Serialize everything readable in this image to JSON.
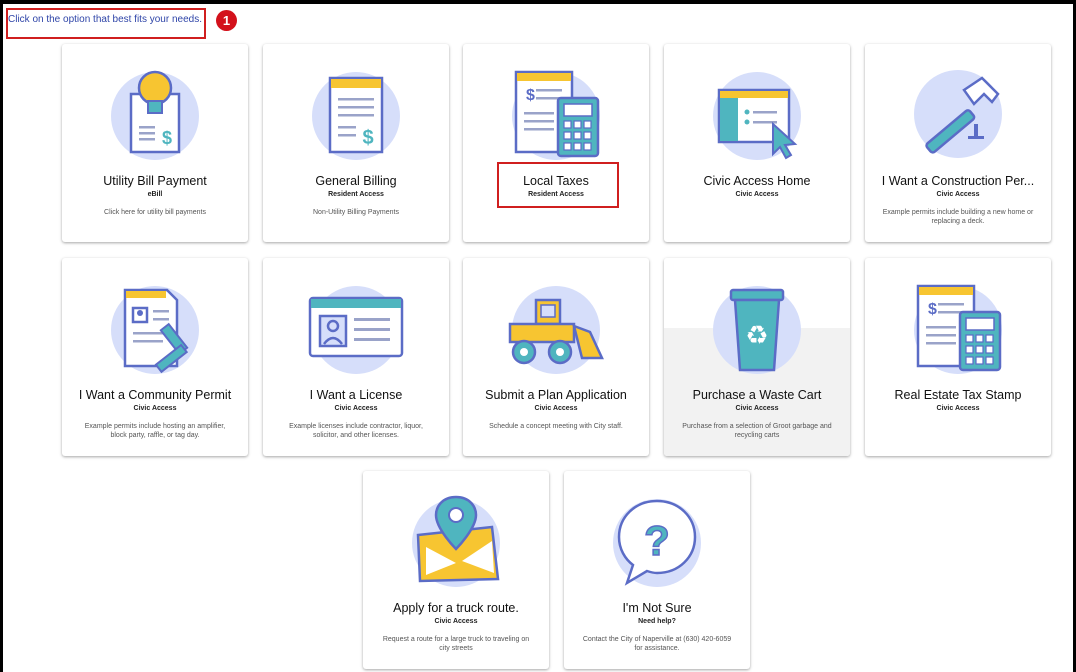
{
  "instruction": "Click on the option that best fits your needs.",
  "step_badge": "1",
  "cards": [
    {
      "title": "Utility Bill Payment",
      "subtitle": "eBill",
      "description": "Click here for utility bill payments",
      "icon": "lightbulb-bill-icon"
    },
    {
      "title": "General Billing",
      "subtitle": "Resident Access",
      "description": "Non-Utility Billing Payments",
      "icon": "bill-document-icon"
    },
    {
      "title": "Local Taxes",
      "subtitle": "Resident Access",
      "description": "",
      "icon": "calculator-bill-icon"
    },
    {
      "title": "Civic Access Home",
      "subtitle": "Civic Access",
      "description": "",
      "icon": "browser-cursor-icon"
    },
    {
      "title": "I Want a Construction Per...",
      "subtitle": "Civic Access",
      "description": "Example permits include building a new home or replacing a deck.",
      "icon": "hammer-icon"
    },
    {
      "title": "I Want a Community Permit",
      "subtitle": "Civic Access",
      "description": "Example permits include hosting an amplifier, block party, raffle, or tag day.",
      "icon": "permit-stamp-icon"
    },
    {
      "title": "I Want a License",
      "subtitle": "Civic Access",
      "description": "Example licenses include contractor, liquor, solicitor, and other licenses.",
      "icon": "id-card-icon"
    },
    {
      "title": "Submit a Plan Application",
      "subtitle": "Civic Access",
      "description": "Schedule a concept meeting with City staff.",
      "icon": "bulldozer-icon"
    },
    {
      "title": "Purchase a Waste Cart",
      "subtitle": "Civic Access",
      "description": "Purchase from a selection of Groot garbage and recycling carts",
      "icon": "recycle-cart-icon"
    },
    {
      "title": "Real Estate Tax Stamp",
      "subtitle": "Civic Access",
      "description": "",
      "icon": "calculator-bill-icon"
    },
    {
      "title": "Apply for a truck route.",
      "subtitle": "Civic Access",
      "description": "Request a route for a large truck to traveling on city streets",
      "icon": "map-pin-icon"
    },
    {
      "title": "I'm Not Sure",
      "subtitle": "Need help?",
      "description": "Contact the City of Naperville at (630) 420-6059 for assistance.",
      "icon": "question-bubble-icon"
    }
  ],
  "colors": {
    "accent_blue": "#5b6cc6",
    "teal": "#4fb5bf",
    "yellow": "#f7c531",
    "highlight_red": "#d01f1f",
    "circle_bg": "#d6defa"
  }
}
